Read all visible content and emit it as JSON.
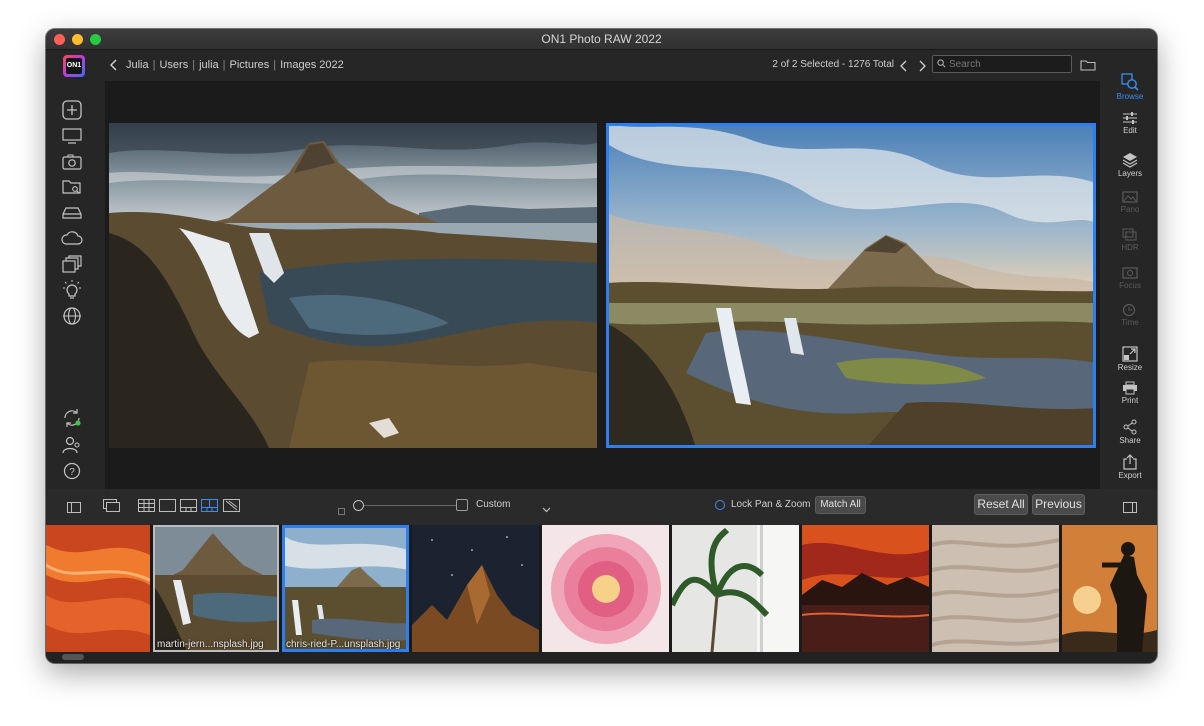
{
  "window": {
    "title": "ON1 Photo RAW 2022"
  },
  "logo": {
    "text": "ON1"
  },
  "breadcrumb": [
    "Julia",
    "Users",
    "julia",
    "Pictures",
    "Images 2022"
  ],
  "selection": {
    "text": "2 of 2 Selected - 1276 Total"
  },
  "search": {
    "placeholder": "Search"
  },
  "left_sidebar": {
    "icons": [
      "add-icon",
      "monitor-icon",
      "camera-icon",
      "folder-search-icon",
      "drive-icon",
      "cloud-icon",
      "albums-icon",
      "lightbulb-icon",
      "globe-icon",
      "sync-icon",
      "people-icon",
      "help-icon"
    ]
  },
  "modules": [
    {
      "label": "Browse",
      "state": "active"
    },
    {
      "label": "Edit",
      "state": "normal"
    },
    {
      "label": "Layers",
      "state": "normal"
    },
    {
      "label": "Pano",
      "state": "disabled"
    },
    {
      "label": "HDR",
      "state": "disabled"
    },
    {
      "label": "Focus",
      "state": "disabled"
    },
    {
      "label": "Time",
      "state": "disabled"
    },
    {
      "label": "Resize",
      "state": "normal"
    },
    {
      "label": "Print",
      "state": "normal"
    },
    {
      "label": "Share",
      "state": "normal"
    },
    {
      "label": "Export",
      "state": "normal"
    }
  ],
  "toolbar": {
    "custom_label": "Custom",
    "lock_label": "Lock Pan & Zoom",
    "match_label": "Match All",
    "reset_label": "Reset All",
    "previous_label": "Previous"
  },
  "filmstrip": {
    "captions": [
      "martin-jern...nsplash.jpg",
      "chris-ried-P...unsplash.jpg"
    ]
  },
  "colors": {
    "accent": "#2d7ff0",
    "background": "#262626",
    "viewer": "#1b1b1b"
  }
}
